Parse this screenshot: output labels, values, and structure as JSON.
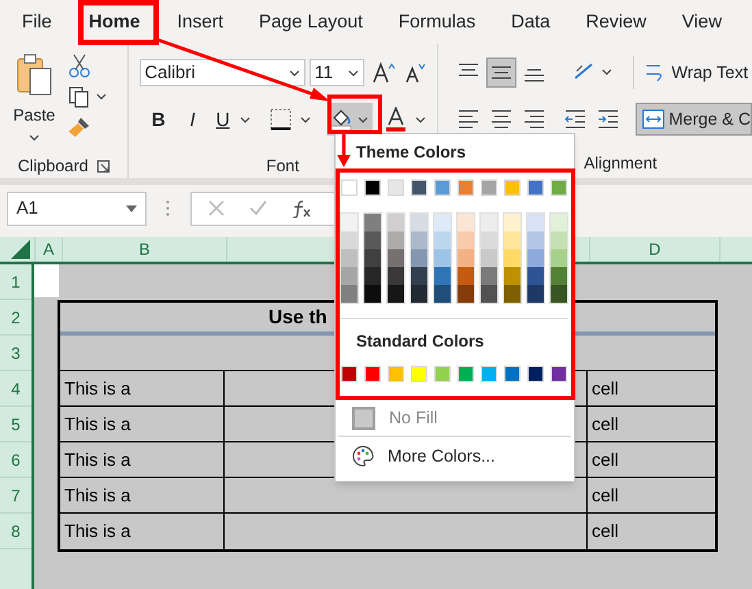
{
  "tabs": [
    {
      "label": "File",
      "selected": false
    },
    {
      "label": "Home",
      "selected": true
    },
    {
      "label": "Insert",
      "selected": false
    },
    {
      "label": "Page Layout",
      "selected": false
    },
    {
      "label": "Formulas",
      "selected": false
    },
    {
      "label": "Data",
      "selected": false
    },
    {
      "label": "Review",
      "selected": false
    },
    {
      "label": "View",
      "selected": false
    }
  ],
  "ribbon": {
    "clipboard": {
      "label": "Clipboard",
      "paste": "Paste"
    },
    "font": {
      "label": "Font",
      "font_name": "Calibri",
      "font_size": "11",
      "bold": "B",
      "italic": "I",
      "underline": "U"
    },
    "alignment": {
      "label": "Alignment",
      "wrap_text": "Wrap Text",
      "merge": "Merge & C"
    }
  },
  "formula_bar": {
    "name_box": "A1"
  },
  "column_headers": [
    "A",
    "B",
    "D"
  ],
  "row_headers": [
    "1",
    "2",
    "3",
    "4",
    "5",
    "6",
    "7",
    "8"
  ],
  "sheet": {
    "title": "Use th",
    "rows": [
      {
        "column_b": "This is a",
        "column_d": "cell"
      },
      {
        "column_b": "This is a",
        "column_d": "cell"
      },
      {
        "column_b": "This is a",
        "column_d": "cell"
      },
      {
        "column_b": "This is a",
        "column_d": "cell"
      },
      {
        "column_b": "This is a",
        "column_d": "cell"
      }
    ]
  },
  "fill_menu": {
    "theme_title": "Theme Colors",
    "theme": [
      {
        "color": "#ffffff",
        "shades": [
          {
            "color": "#f2f2f2"
          },
          {
            "color": "#d9d9d9"
          },
          {
            "color": "#bfbfbf"
          },
          {
            "color": "#a6a6a6"
          },
          {
            "color": "#808080"
          }
        ]
      },
      {
        "color": "#000000",
        "shades": [
          {
            "color": "#7f7f7f"
          },
          {
            "color": "#595959"
          },
          {
            "color": "#404040"
          },
          {
            "color": "#262626"
          },
          {
            "color": "#0d0d0d"
          }
        ]
      },
      {
        "color": "#e7e6e6",
        "shades": [
          {
            "color": "#d0cece"
          },
          {
            "color": "#aeabab"
          },
          {
            "color": "#757171"
          },
          {
            "color": "#3a3838"
          },
          {
            "color": "#171616"
          }
        ]
      },
      {
        "color": "#44546a",
        "shades": [
          {
            "color": "#d6dce4"
          },
          {
            "color": "#adb9ca"
          },
          {
            "color": "#8496b0"
          },
          {
            "color": "#333f4f"
          },
          {
            "color": "#222a35"
          }
        ]
      },
      {
        "color": "#5b9bd5",
        "shades": [
          {
            "color": "#deebf6"
          },
          {
            "color": "#bdd7ee"
          },
          {
            "color": "#9dc3e6"
          },
          {
            "color": "#2e75b5"
          },
          {
            "color": "#1f4e79"
          }
        ]
      },
      {
        "color": "#ed7d31",
        "shades": [
          {
            "color": "#fbe5d5"
          },
          {
            "color": "#f8cbad"
          },
          {
            "color": "#f4b183"
          },
          {
            "color": "#c55a11"
          },
          {
            "color": "#843c0b"
          }
        ]
      },
      {
        "color": "#a5a5a5",
        "shades": [
          {
            "color": "#ededed"
          },
          {
            "color": "#dbdbdb"
          },
          {
            "color": "#c9c9c9"
          },
          {
            "color": "#7b7b7b"
          },
          {
            "color": "#525252"
          }
        ]
      },
      {
        "color": "#ffc000",
        "shades": [
          {
            "color": "#fff2cc"
          },
          {
            "color": "#fee599"
          },
          {
            "color": "#ffd965"
          },
          {
            "color": "#bf9000"
          },
          {
            "color": "#7f6000"
          }
        ]
      },
      {
        "color": "#4472c4",
        "shades": [
          {
            "color": "#d9e2f3"
          },
          {
            "color": "#b4c6e7"
          },
          {
            "color": "#8eaadb"
          },
          {
            "color": "#2f5496"
          },
          {
            "color": "#1f3864"
          }
        ]
      },
      {
        "color": "#70ad47",
        "shades": [
          {
            "color": "#e2efd9"
          },
          {
            "color": "#c5e0b3"
          },
          {
            "color": "#a8d08d"
          },
          {
            "color": "#538135"
          },
          {
            "color": "#375623"
          }
        ]
      }
    ],
    "standard_title": "Standard Colors",
    "standard": [
      {
        "color": "#c00000"
      },
      {
        "color": "#ff0000"
      },
      {
        "color": "#ffc000"
      },
      {
        "color": "#ffff00"
      },
      {
        "color": "#92d050"
      },
      {
        "color": "#00b050"
      },
      {
        "color": "#00b0f0"
      },
      {
        "color": "#0070c0"
      },
      {
        "color": "#002060"
      },
      {
        "color": "#7030a0"
      }
    ],
    "no_fill": {
      "label": "No Fill",
      "disabled": true
    },
    "more_colors": "More Colors..."
  }
}
